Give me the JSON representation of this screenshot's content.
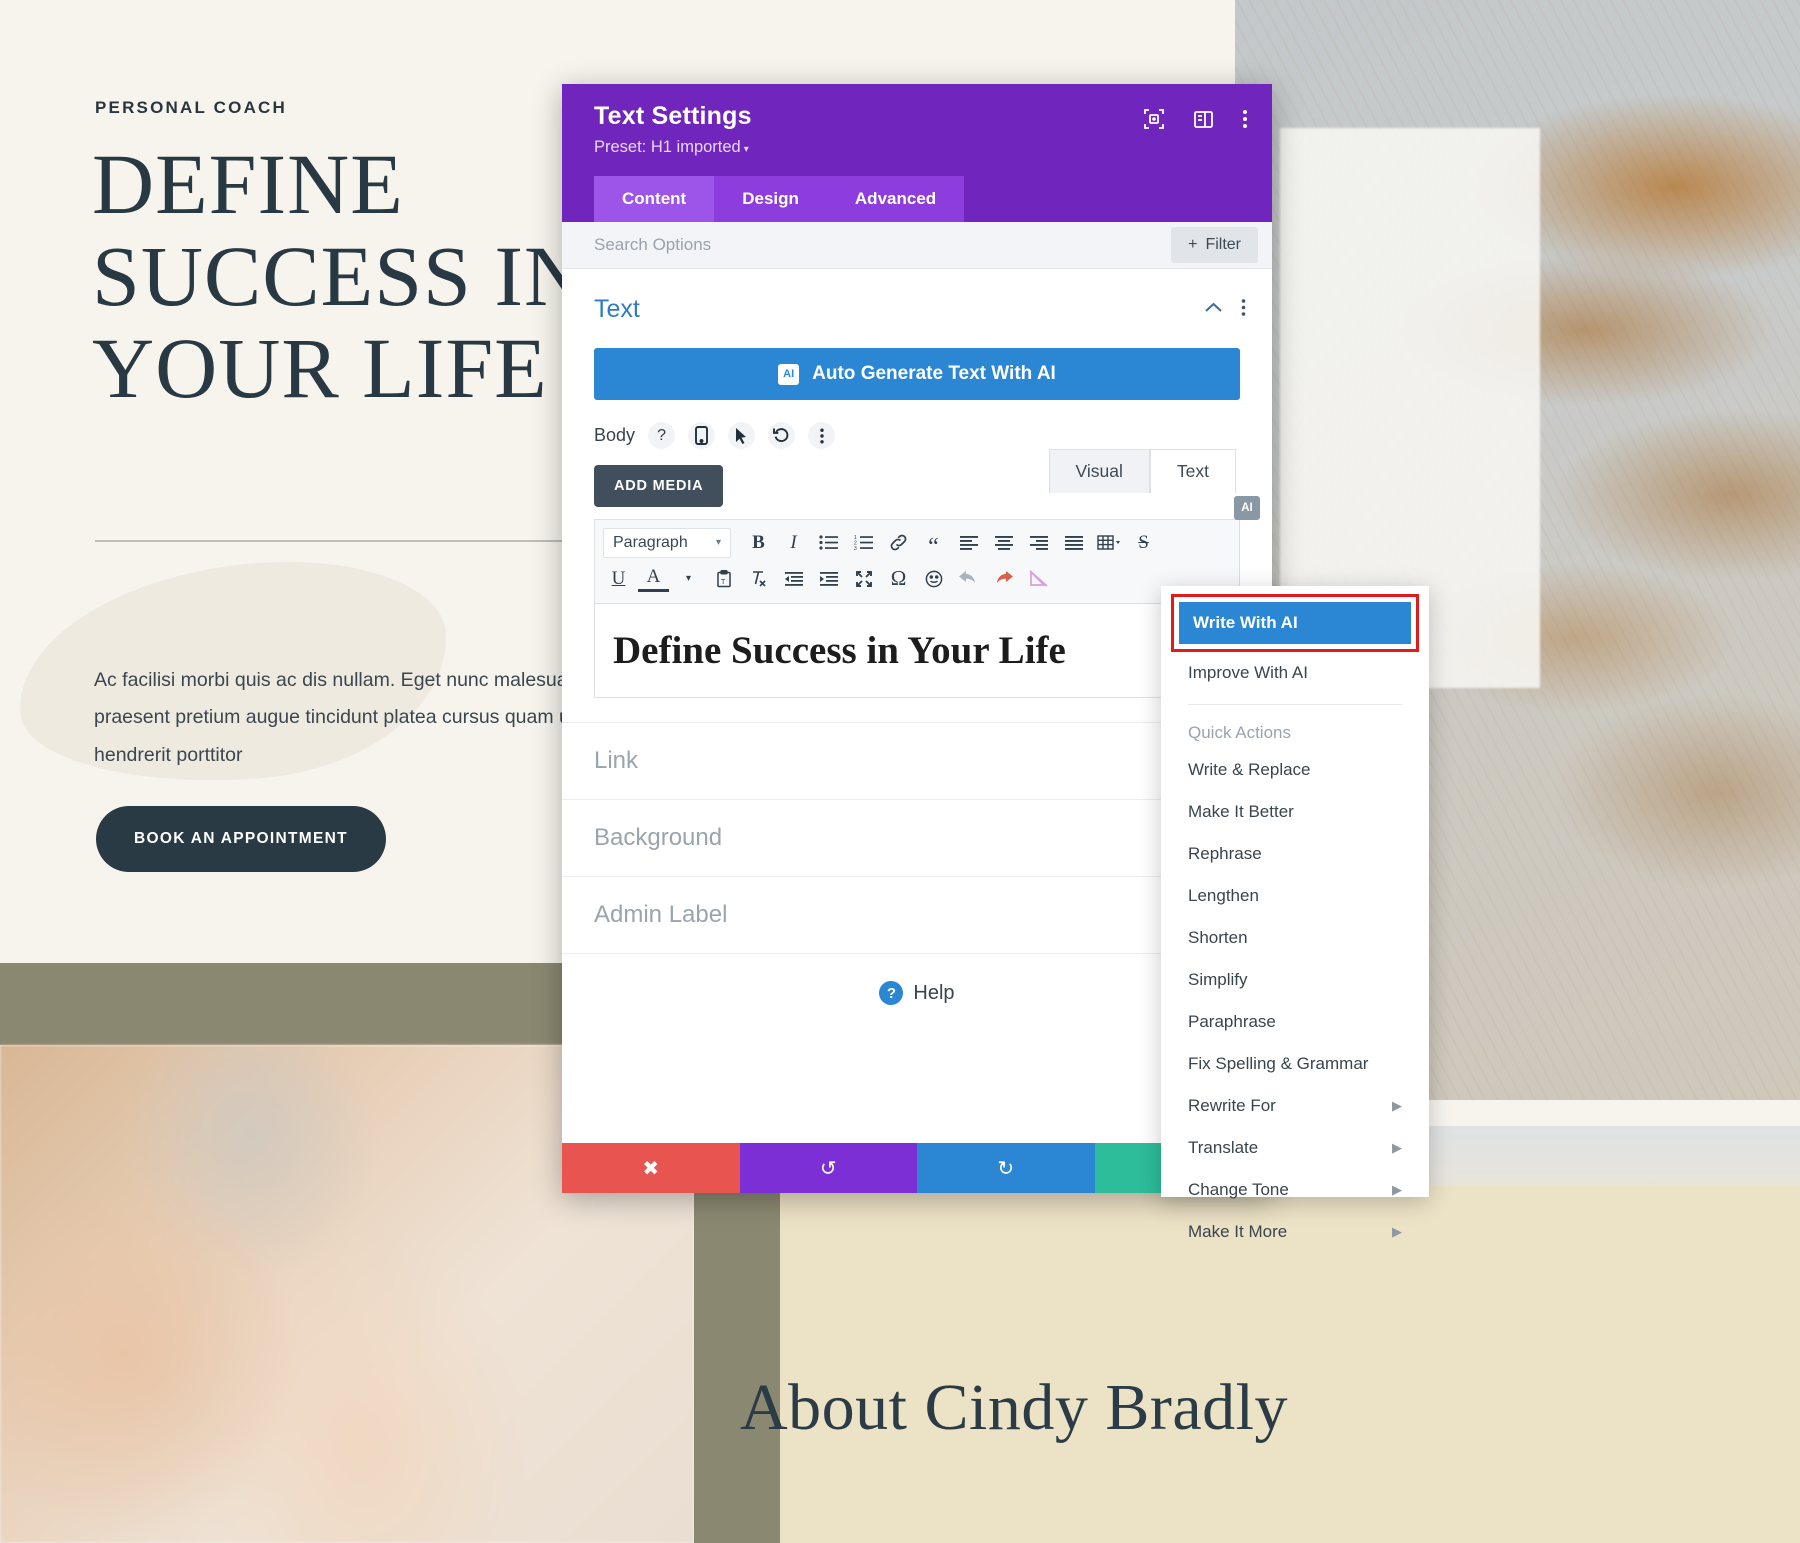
{
  "page": {
    "eyebrow": "PERSONAL COACH",
    "hero_title": "DEFINE SUCCESS IN YOUR LIFE",
    "hero_body": "Ac facilisi morbi quis ac dis nullam. Eget nunc malesuada hac vestibulum. Luctus praesent pretium augue tincidunt platea cursus quam ultricies. Turpis leo hendrerit porttitor",
    "cta_label": "BOOK AN APPOINTMENT",
    "about_title": "About Cindy Bradly"
  },
  "modal": {
    "title": "Text Settings",
    "preset": "Preset: H1 imported",
    "preset_caret": "▾",
    "header_icons": [
      "focus-target-icon",
      "layout-panel-icon",
      "kebab-menu-icon"
    ],
    "tabs": [
      {
        "label": "Content",
        "active": true
      },
      {
        "label": "Design",
        "active": false
      },
      {
        "label": "Advanced",
        "active": false
      }
    ],
    "search_placeholder": "Search Options",
    "filter_label": "Filter",
    "filter_plus": "+",
    "section": {
      "title": "Text",
      "collapse_icon": "chevron-up-icon",
      "more_icon": "kebab-menu-icon"
    },
    "ai_button": {
      "chip": "AI",
      "label": "Auto Generate Text With AI"
    },
    "body_row": {
      "label": "Body",
      "icons": [
        "help-icon",
        "mobile-icon",
        "cursor-icon",
        "reset-icon",
        "kebab-menu-icon"
      ],
      "glyphs": [
        "?",
        "▯",
        "➤",
        "↺",
        "⋮"
      ]
    },
    "add_media_label": "ADD MEDIA",
    "editor_tabs": [
      {
        "label": "Visual",
        "active": true
      },
      {
        "label": "Text",
        "active": false
      }
    ],
    "toolbar": {
      "format_select": "Paragraph",
      "row1": [
        "bold",
        "italic",
        "bulleted-list",
        "numbered-list",
        "link",
        "blockquote",
        "align-left",
        "align-center",
        "align-right",
        "align-justify",
        "table",
        "strikethrough"
      ],
      "row1_glyphs": [
        "B",
        "I",
        "☰",
        "☷",
        "⛓",
        "“",
        "≡",
        "≡",
        "≡",
        "≡",
        "▦",
        "S"
      ],
      "row2": [
        "underline",
        "text-color",
        "paste-as-text",
        "clear-formatting",
        "outdent",
        "indent",
        "fullscreen",
        "special-character",
        "emoji",
        "undo",
        "redo",
        "no-image"
      ],
      "row2_glyphs": [
        "U",
        "A",
        "⎘",
        "✗",
        "⇤",
        "⇥",
        "⤢",
        "Ω",
        "☺",
        "↶",
        "↷",
        "◢"
      ]
    },
    "editor_content": "Define Success in Your Life",
    "ai_badge": "AI",
    "option_rows": [
      "Link",
      "Background",
      "Admin Label"
    ],
    "help_label": "Help",
    "help_glyph": "?",
    "footer_buttons": [
      {
        "name": "close-button",
        "glyph": "✖",
        "color": "#e8544f"
      },
      {
        "name": "undo-button",
        "glyph": "↺",
        "color": "#7c2fd4"
      },
      {
        "name": "redo-button",
        "glyph": "↻",
        "color": "#2b87d3"
      },
      {
        "name": "save-button",
        "glyph": "✓",
        "color": "#2dbd9a"
      }
    ]
  },
  "ai_menu": {
    "primary": "Write With AI",
    "secondary": "Improve With AI",
    "group_label": "Quick Actions",
    "items": [
      {
        "label": "Write & Replace",
        "submenu": false
      },
      {
        "label": "Make It Better",
        "submenu": false
      },
      {
        "label": "Rephrase",
        "submenu": false
      },
      {
        "label": "Lengthen",
        "submenu": false
      },
      {
        "label": "Shorten",
        "submenu": false
      },
      {
        "label": "Simplify",
        "submenu": false
      },
      {
        "label": "Paraphrase",
        "submenu": false
      },
      {
        "label": "Fix Spelling & Grammar",
        "submenu": false
      },
      {
        "label": "Rewrite For",
        "submenu": true
      },
      {
        "label": "Translate",
        "submenu": true
      },
      {
        "label": "Change Tone",
        "submenu": true
      },
      {
        "label": "Make It More",
        "submenu": true
      }
    ],
    "submenu_caret": "▶",
    "highlight_color": "#e01b1b"
  }
}
